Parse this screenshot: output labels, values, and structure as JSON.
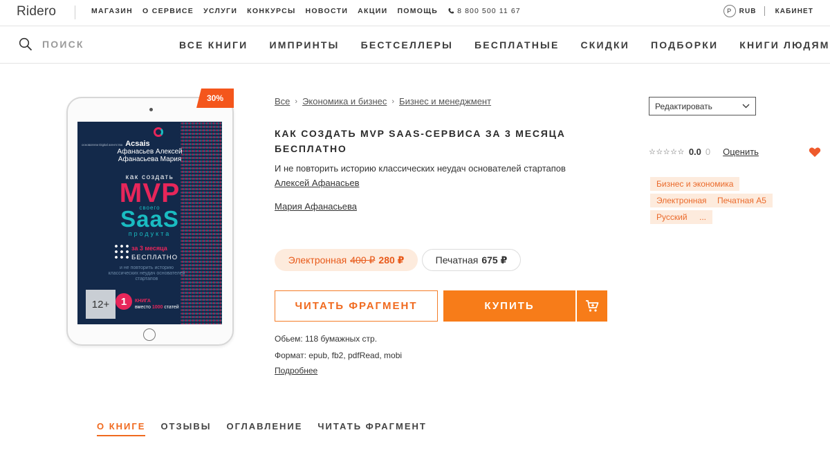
{
  "header": {
    "logo": "Ridero",
    "nav": [
      "МАГАЗИН",
      "О СЕРВИСЕ",
      "УСЛУГИ",
      "КОНКУРСЫ",
      "НОВОСТИ",
      "АКЦИИ",
      "ПОМОЩЬ"
    ],
    "phone": "8 800 500 11 67",
    "currency_badge": "P",
    "currency": "RUB",
    "cabinet": "КАБИНЕТ"
  },
  "search": {
    "placeholder": "ПОИСК"
  },
  "catnav": [
    "ВСЕ КНИГИ",
    "ИМПРИНТЫ",
    "БЕСТСЕЛЛЕРЫ",
    "БЕСПЛАТНЫЕ",
    "СКИДКИ",
    "ПОДБОРКИ",
    "КНИГИ ЛЮДЯМ"
  ],
  "cover": {
    "discount": "30%",
    "brand_sub": "основатели Digital агентства",
    "brand": "Acsais",
    "authors_line1": "Афанасьев Алексей",
    "authors_line2": "Афанасьева Мария",
    "how": "как создать",
    "mvp": "MVP",
    "svoego": "своего",
    "saas": "SaaS",
    "product": "продукта",
    "months": "за 3 месяца",
    "free": "БЕСПЛАТНО",
    "not_repeat": "и не повторить историю классических неудач основателей стартапов",
    "age": "12+",
    "one": "1",
    "one_line1": "КНИГА",
    "one_line2_pre": "вместо",
    "one_line2_num": "1000",
    "one_line2_post": "статей"
  },
  "breadcrumb": [
    "Все",
    "Экономика и бизнес",
    "Бизнес и менеджмент"
  ],
  "book": {
    "title": "КАК СОЗДАТЬ MVP SAAS-СЕРВИСА ЗА 3 МЕСЯЦА БЕСПЛАТНО",
    "subtitle": "И не повторить историю классических неудач основателей стартапов",
    "authors": [
      "Алексей Афанасьев",
      "Мария Афанасьева"
    ],
    "formats": {
      "ebook": {
        "label": "Электронная",
        "old_price": "400 ₽",
        "price": "280 ₽"
      },
      "print": {
        "label": "Печатная",
        "price": "675 ₽"
      }
    },
    "read_fragment": "ЧИТАТЬ ФРАГМЕНТ",
    "buy": "КУПИТЬ",
    "volume": "Обьем: 118 бумажных стр.",
    "format_line": "Формат: epub, fb2, pdfRead, mobi",
    "more": "Подробнее"
  },
  "sidebar": {
    "edit": "Редактировать",
    "stars": "☆☆☆☆☆",
    "score": "0.0",
    "count": "0",
    "rate": "Оценить",
    "tags": [
      "Бизнес и экономика",
      "Электронная",
      "Печатная A5",
      "Русский",
      "..."
    ]
  },
  "tabs": [
    "О КНИГЕ",
    "ОТЗЫВЫ",
    "ОГЛАВЛЕНИЕ",
    "ЧИТАТЬ ФРАГМЕНТ"
  ],
  "colors": {
    "accent": "#f77c19",
    "accent_text": "#f06a1f",
    "tag_bg": "#fdebdd",
    "cover_bg": "#13294a",
    "cover_pink": "#e7265a",
    "cover_teal": "#1abcc1"
  }
}
